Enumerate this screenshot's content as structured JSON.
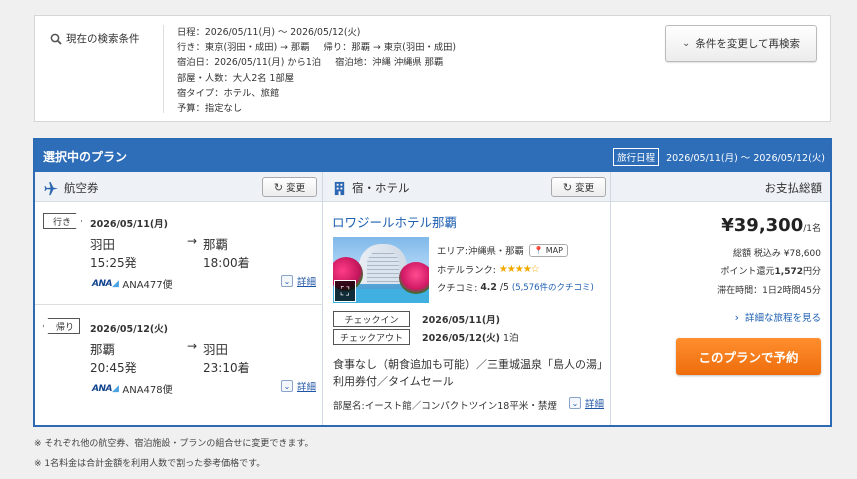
{
  "conditions": {
    "title": "現在の検索条件",
    "lines": [
      [
        "日程：2026/05/11(月) ～ 2026/05/12(火)"
      ],
      [
        "行き：東京(羽田・成田) → 那覇",
        "帰り：那覇 → 東京(羽田・成田)"
      ],
      [
        "宿泊日：2026/05/11(月) から1泊",
        "宿泊地：沖縄 沖縄県 那覇"
      ],
      [
        "部屋・人数：大人2名 1部屋"
      ],
      [
        "宿タイプ：ホテル、旅館"
      ],
      [
        "予算：指定なし"
      ]
    ],
    "research_button": "条件を変更して再検索"
  },
  "plan": {
    "title": "選択中のプラン",
    "trip_label": "旅行日程",
    "trip_dates": "2026/05/11(月) 〜 2026/05/12(火)"
  },
  "flight": {
    "header": "航空券",
    "change": "変更",
    "legs": [
      {
        "tag": "行き",
        "date": "2026/05/11(月)",
        "from": "羽田",
        "arrow": "→",
        "to": "那覇",
        "dep": "15:25発",
        "arr": "18:00着",
        "airline": "ANA477便",
        "detail": "詳細"
      },
      {
        "tag": "帰り",
        "date": "2026/05/12(火)",
        "from": "那覇",
        "arrow": "→",
        "to": "羽田",
        "dep": "20:45発",
        "arr": "23:10着",
        "airline": "ANA478便",
        "detail": "詳細"
      }
    ]
  },
  "hotel": {
    "header": "宿・ホテル",
    "change": "変更",
    "name": "ロワジールホテル那覇",
    "area": "エリア:沖縄県・那覇",
    "map": "MAP",
    "rank_label": "ホテルランク:",
    "rank_stars": 3.5,
    "kuchikomi_label": "クチコミ:",
    "kuchikomi_score": "4.2",
    "kuchikomi_max": "/5",
    "kuchikomi_count": "(5,576件のクチコミ)",
    "checkin_label": "チェックイン",
    "checkin": "2026/05/11(月)",
    "checkout_label": "チェックアウト",
    "checkout": "2026/05/12(火)",
    "nights": "1泊",
    "meal": "食事なし（朝食追加も可能）／三重城温泉「島人の湯」利用券付／タイムセール",
    "room": "部屋名:イースト館／コンパクトツイン18平米・禁煙",
    "detail": "詳細"
  },
  "payment": {
    "header": "お支払総額",
    "price": "¥39,300",
    "per": "/1名",
    "total": "総額 税込み ¥78,600",
    "points_prefix": "ポイント還元",
    "points": "1,572",
    "points_suffix": "円分",
    "stay": "滞在時間：1日2時間45分",
    "itinerary": "詳細な旅程を見る",
    "reserve": "このプランで予約"
  },
  "notes": [
    "※ それぞれ他の航空券、宿泊施設・プランの組合せに変更できます。",
    "※ 1名料金は合計金額を利用人数で割った参考価格です。"
  ],
  "colors": {
    "brand_blue": "#2e6db8",
    "link": "#1d5fb2",
    "reserve": "#f07a18"
  }
}
